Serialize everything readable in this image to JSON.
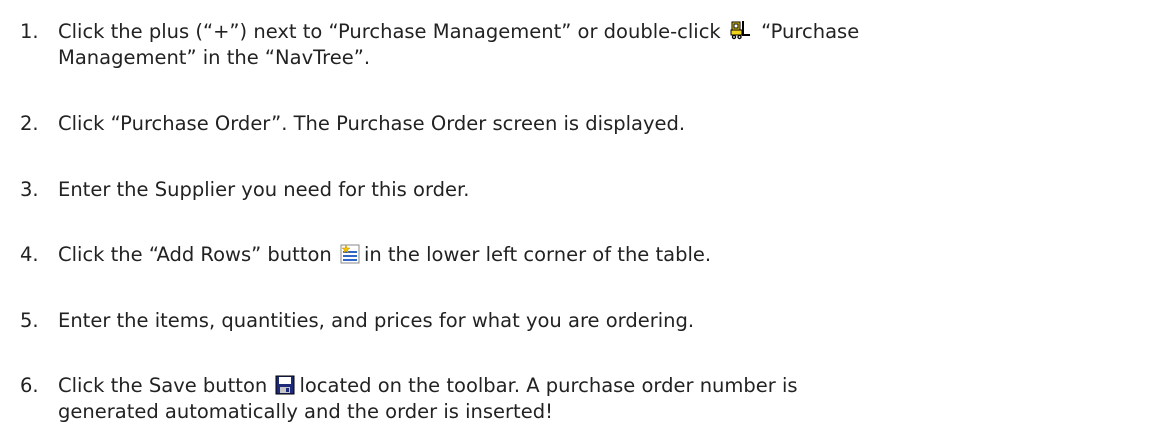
{
  "steps": [
    {
      "num": "1.",
      "text_before_icon": "Click the plus (“+”) next to “Purchase Management” or double-click",
      "icon": "forklift-icon",
      "text_after_icon": " “Purchase",
      "line2": "Management” in the “NavTree”."
    },
    {
      "num": "2.",
      "text": "Click “Purchase Order”.  The Purchase Order screen is displayed."
    },
    {
      "num": "3.",
      "text": "Enter the Supplier you need for this order."
    },
    {
      "num": "4.",
      "text_before_icon": "Click the “Add Rows” button",
      "icon": "add-rows-icon",
      "text_after_icon": "in the lower left corner of the table."
    },
    {
      "num": "5.",
      "text": "Enter the items, quantities, and prices for what you are ordering."
    },
    {
      "num": "6.",
      "text_before_icon": "Click the Save button",
      "icon": "save-icon",
      "text_after_icon": "located on the toolbar. A purchase order number is",
      "line2": "generated automatically and the order is inserted!"
    }
  ]
}
